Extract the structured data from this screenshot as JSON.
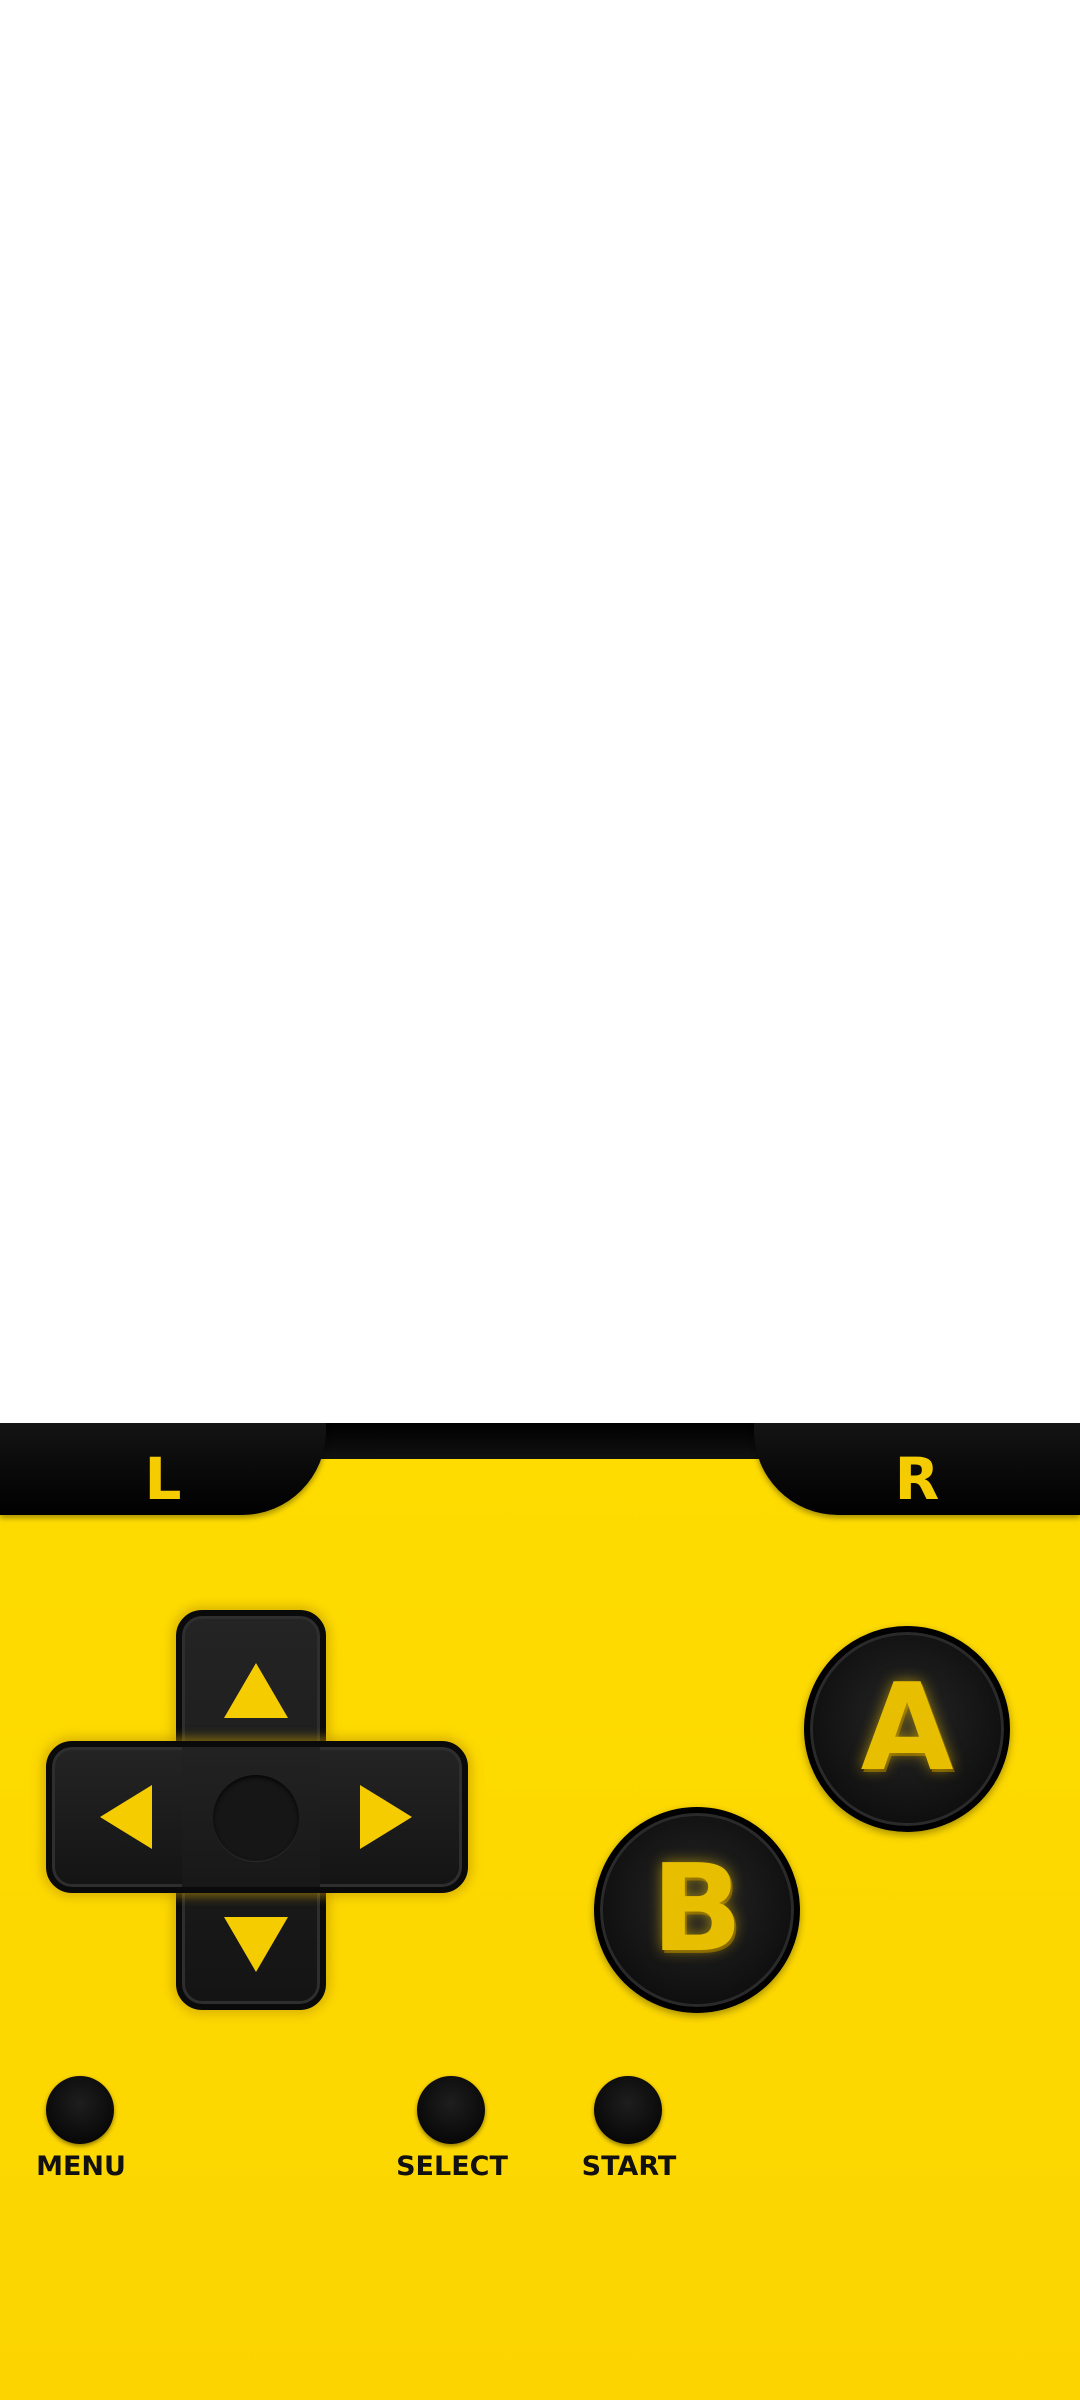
{
  "screen": {
    "background": "#ffffff"
  },
  "controller": {
    "background": "#fedc00",
    "accent": "#f5cc00",
    "shoulders": {
      "left_label": "L",
      "right_label": "R"
    },
    "face_buttons": {
      "a_label": "A",
      "b_label": "B"
    },
    "dpad": {
      "up": "up-arrow-icon",
      "down": "down-arrow-icon",
      "left": "left-arrow-icon",
      "right": "right-arrow-icon"
    },
    "small_buttons": {
      "menu_label": "MENU",
      "select_label": "SELECT",
      "start_label": "START"
    }
  }
}
